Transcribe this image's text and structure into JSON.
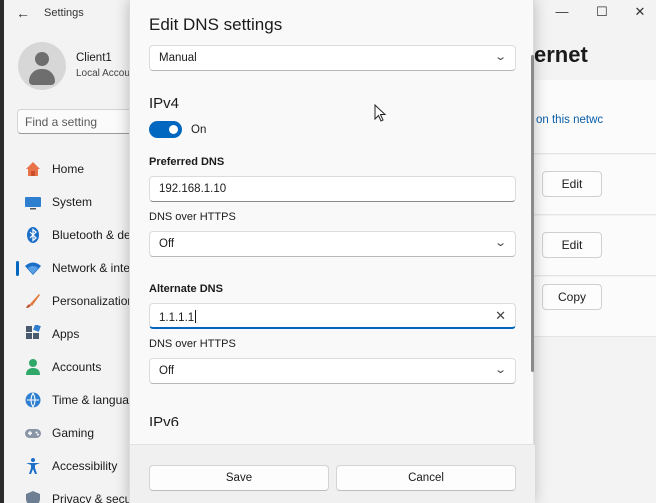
{
  "window": {
    "title": "Settings",
    "back_glyph": "←",
    "minimize_glyph": "—",
    "maximize_glyph": "☐",
    "close_glyph": "✕"
  },
  "profile": {
    "name": "Client1",
    "subtitle": "Local Accou"
  },
  "search": {
    "placeholder": "Find a setting"
  },
  "nav": {
    "items": [
      {
        "label": "Home",
        "icon": "home-icon"
      },
      {
        "label": "System",
        "icon": "system-icon"
      },
      {
        "label": "Bluetooth & de",
        "icon": "bluetooth-icon"
      },
      {
        "label": "Network & inte",
        "icon": "network-icon",
        "active": true
      },
      {
        "label": "Personalization",
        "icon": "brush-icon"
      },
      {
        "label": "Apps",
        "icon": "apps-icon"
      },
      {
        "label": "Accounts",
        "icon": "accounts-icon"
      },
      {
        "label": "Time & langua",
        "icon": "globe-icon"
      },
      {
        "label": "Gaming",
        "icon": "gamepad-icon"
      },
      {
        "label": "Accessibility",
        "icon": "accessibility-icon"
      },
      {
        "label": "Privacy & secu",
        "icon": "shield-icon"
      }
    ]
  },
  "right_pane": {
    "title": "ernet",
    "link": "on this netwc",
    "edit_label_1": "Edit",
    "edit_label_2": "Edit",
    "copy_label": "Copy"
  },
  "dialog": {
    "title": "Edit DNS settings",
    "mode": "Manual",
    "ipv4": {
      "heading": "IPv4",
      "toggle_state": "On",
      "toggle_on": true,
      "preferred_label": "Preferred DNS",
      "preferred_value": "192.168.1.10",
      "preferred_doh_label": "DNS over HTTPS",
      "preferred_doh_value": "Off",
      "alternate_label": "Alternate DNS",
      "alternate_value": "1.1.1.1",
      "alternate_doh_label": "DNS over HTTPS",
      "alternate_doh_value": "Off"
    },
    "ipv6": {
      "heading": "IPv6"
    },
    "save_label": "Save",
    "cancel_label": "Cancel",
    "chevron_glyph": "⌄",
    "clear_glyph": "✕"
  },
  "colors": {
    "accent": "#0067c0",
    "dialog_bg": "#f9f9f9",
    "window_bg": "#f3f3f3"
  }
}
